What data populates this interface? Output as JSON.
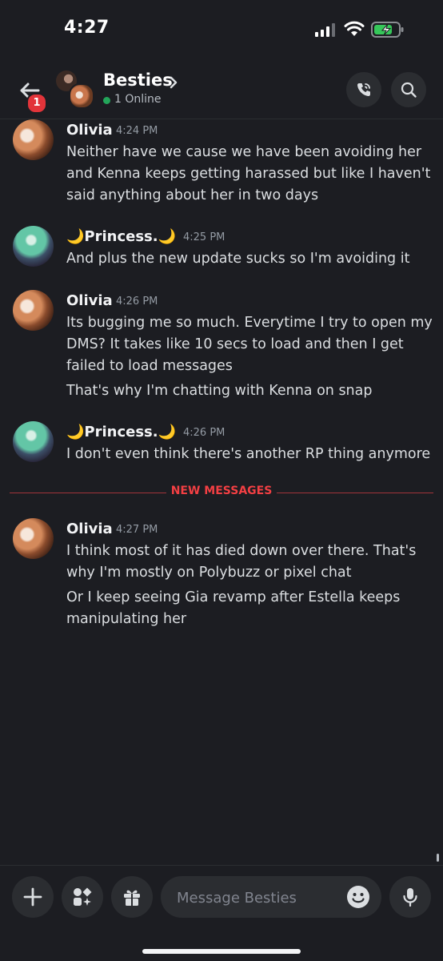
{
  "status_bar": {
    "time": "4:27"
  },
  "header": {
    "back_badge": "1",
    "group_name": "Besties",
    "online_text": "1 Online"
  },
  "messages": [
    {
      "author": "Olivia",
      "time": "4:24 PM",
      "lines": [
        "Neither have we cause we have been avoiding her",
        "and Kenna keeps getting harassed but like I haven't",
        "said anything about her in two days"
      ]
    },
    {
      "author": "🌙Princess.🌙",
      "time": "4:25 PM",
      "lines": [
        "And plus the new update sucks so I'm avoiding it"
      ]
    },
    {
      "author": "Olivia",
      "time": "4:26 PM",
      "lines": [
        "Its bugging me so much. Everytime I try to open my",
        "DMS? It takes like 10 secs to load and then I get",
        "failed to load messages",
        "That's why I'm chatting with Kenna on snap"
      ]
    },
    {
      "author": "🌙Princess.🌙",
      "time": "4:26 PM",
      "lines": [
        "I don't even think there's another RP thing anymore"
      ]
    },
    {
      "author": "Olivia",
      "time": "4:27 PM",
      "lines": [
        "I think most of it has died down over there. That's",
        "why I'm mostly on Polybuzz or pixel chat",
        "Or I keep seeing Gia revamp after Estella keeps",
        "manipulating her"
      ]
    }
  ],
  "divider": {
    "label": "NEW MESSAGES"
  },
  "composer": {
    "placeholder": "Message Besties"
  },
  "colors": {
    "background": "#1c1d22",
    "new_messages": "#f23f43",
    "online": "#23a55a",
    "badge": "#e2343a"
  }
}
